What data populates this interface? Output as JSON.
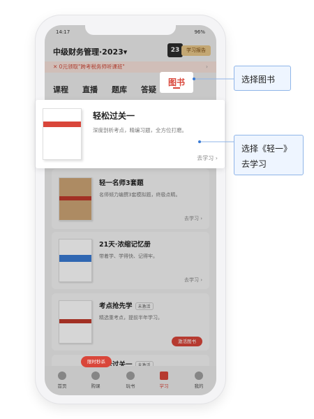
{
  "status": {
    "time": "14:17",
    "battery": "96%"
  },
  "header": {
    "course_title": "中级财务管理·2023▾",
    "year_box": "23",
    "plan_badge": "学习报告"
  },
  "promo": {
    "text": "✕ 0元领取\"跨考税务师听课班\"",
    "arrow": "›"
  },
  "tabs": [
    {
      "label": "课程"
    },
    {
      "label": "直播"
    },
    {
      "label": "题库"
    },
    {
      "label": "答疑"
    },
    {
      "label": "图书"
    }
  ],
  "featured": {
    "title": "轻松过关一",
    "desc": "深度剖析考点，精编习题，全方位打磨。",
    "link": "去学习 ›"
  },
  "books": [
    {
      "title": "轻一名师3套题",
      "desc": "名师倾力编撰3套模拟题，终极点睛。",
      "link": "去学习 ›"
    },
    {
      "title": "21天·浓缩记忆册",
      "desc": "带着学、学得快、记得牢。",
      "link": "去学习 ›"
    },
    {
      "title": "考点抢先学",
      "tag": "未激活",
      "desc": "精选重考点，提前半年学习。",
      "action": "激活图书"
    },
    {
      "title": "轻松过关一",
      "tag": "未激活"
    }
  ],
  "flash_sale": "限时秒杀",
  "bottom_nav": [
    {
      "label": "首页"
    },
    {
      "label": "购课"
    },
    {
      "label": "玩书"
    },
    {
      "label": "学习"
    },
    {
      "label": "我的"
    }
  ],
  "callouts": {
    "select_book": "选择图书",
    "select_book_line1": "选择《轻一》",
    "select_book_line2": "去学习"
  },
  "colors": {
    "accent": "#d9463a",
    "callout_border": "#8fb5e8",
    "callout_bg": "#eef5ff"
  }
}
